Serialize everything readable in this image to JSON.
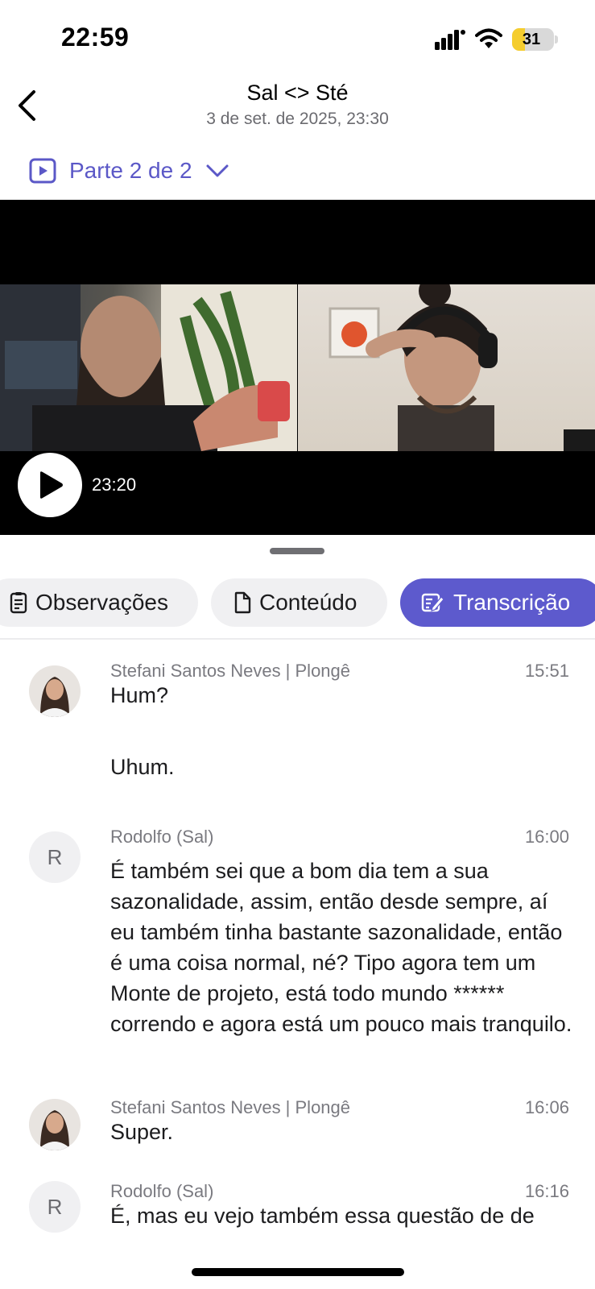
{
  "status_bar": {
    "time": "22:59",
    "battery": "31",
    "battery_level": 0.31
  },
  "header": {
    "title": "Sal <> Sté",
    "subtitle": "3 de set. de 2025, 23:30"
  },
  "part_selector": {
    "label": "Parte 2 de 2"
  },
  "video": {
    "timestamp": "23:20"
  },
  "tabs": [
    {
      "label": "Observações",
      "icon": "notes-icon",
      "active": false
    },
    {
      "label": "Conteúdo",
      "icon": "document-icon",
      "active": false
    },
    {
      "label": "Transcrição",
      "icon": "edit-icon",
      "active": true
    }
  ],
  "transcript": [
    {
      "speaker": "Stefani Santos Neves | Plongê",
      "time": "15:51",
      "avatar": "photo",
      "lines": [
        "Hum?",
        "Uhum."
      ]
    },
    {
      "speaker": "Rodolfo (Sal)",
      "time": "16:00",
      "avatar": "R",
      "lines": [
        "É também sei que a bom dia tem a sua sazonalidade, assim, então desde sempre, aí eu também tinha bastante sazonalidade, então é uma coisa normal, né? Tipo agora tem um Monte de projeto, está todo mundo ****** correndo e agora está um pouco mais tranquilo."
      ]
    },
    {
      "speaker": "Stefani Santos Neves | Plongê",
      "time": "16:06",
      "avatar": "photo",
      "lines": [
        "Super."
      ]
    },
    {
      "speaker": "Rodolfo (Sal)",
      "time": "16:16",
      "avatar": "R",
      "lines": [
        "É, mas eu vejo também essa questão de de"
      ]
    }
  ],
  "colors": {
    "accent": "#5d5acd",
    "accent_text": "#5b58c7",
    "tab_bg": "#f0f0f2",
    "muted": "#7a7a80"
  }
}
